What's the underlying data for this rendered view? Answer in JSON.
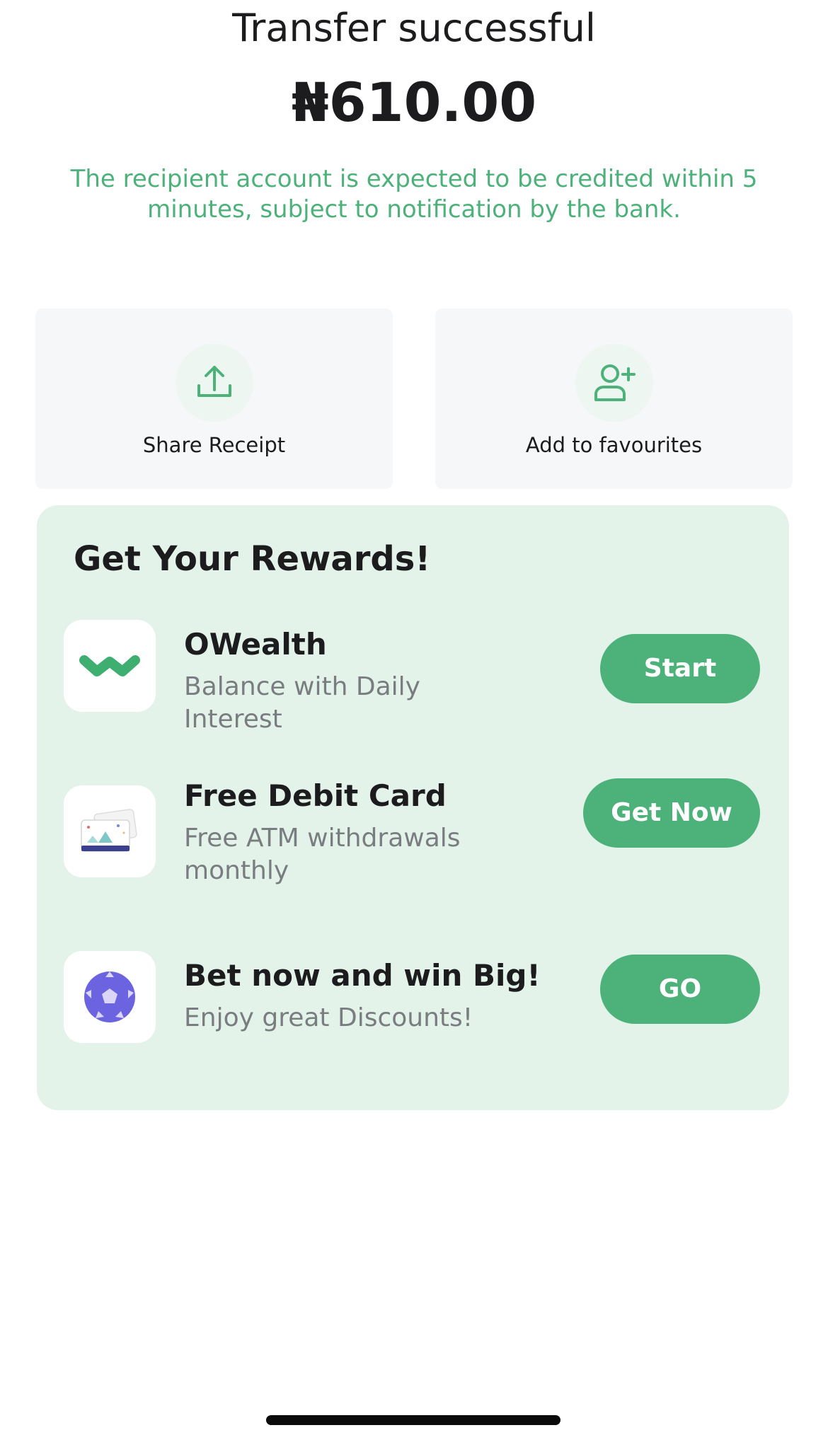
{
  "header": {
    "title": "Transfer successful",
    "amount": "₦610.00",
    "notice": "The recipient account is expected to be credited within 5 minutes, subject to notification by the bank."
  },
  "actions": [
    {
      "label": "Share Receipt",
      "icon": "share-upload-icon"
    },
    {
      "label": "Add to favourites",
      "icon": "add-user-icon"
    }
  ],
  "rewards": {
    "title": "Get Your Rewards!",
    "items": [
      {
        "name": "OWealth",
        "description": "Balance with Daily Interest",
        "button": "Start",
        "icon": "owealth-logo-icon"
      },
      {
        "name": "Free Debit Card",
        "description": "Free ATM withdrawals monthly",
        "button": "Get Now",
        "icon": "debit-card-icon"
      },
      {
        "name": "Bet now and win Big!",
        "description": "Enjoy great Discounts!",
        "button": "GO",
        "icon": "soccer-ball-icon"
      }
    ]
  },
  "colors": {
    "accent": "#4cb27a",
    "rewards_background": "#e3f3ea",
    "card_background": "#f6f7f9",
    "text_primary": "#1c1c1e",
    "text_secondary": "#7a7d80"
  }
}
